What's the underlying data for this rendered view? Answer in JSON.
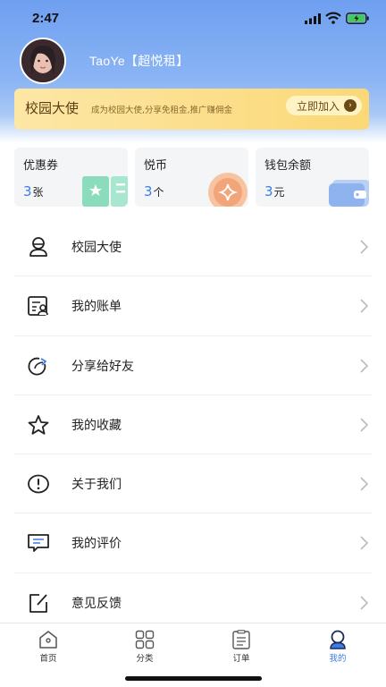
{
  "status_bar": {
    "time": "2:47"
  },
  "profile": {
    "username": "TaoYe【超悦租】"
  },
  "banner": {
    "title": "校园大使",
    "subtitle": "成为校园大使,分享免租金,推广赚佣金",
    "join_label": "立即加入",
    "join_arrow": "›"
  },
  "cards": [
    {
      "title": "优惠券",
      "value": "3",
      "unit": "张",
      "icon": "ticket-icon",
      "accent": "#5ac9a2"
    },
    {
      "title": "悦币",
      "value": "3",
      "unit": "个",
      "icon": "coin-icon",
      "accent": "#f3a57a"
    },
    {
      "title": "钱包余额",
      "value": "3",
      "unit": "元",
      "icon": "wallet-icon",
      "accent": "#8fb3ee"
    }
  ],
  "menu": [
    {
      "label": "校园大使",
      "icon": "ambassador-icon"
    },
    {
      "label": "我的账单",
      "icon": "bill-icon"
    },
    {
      "label": "分享给好友",
      "icon": "share-icon"
    },
    {
      "label": "我的收藏",
      "icon": "star-icon"
    },
    {
      "label": "关于我们",
      "icon": "info-icon"
    },
    {
      "label": "我的评价",
      "icon": "comment-icon"
    },
    {
      "label": "意见反馈",
      "icon": "feedback-icon"
    }
  ],
  "tabbar": [
    {
      "label": "首页",
      "icon": "home-icon",
      "active": false
    },
    {
      "label": "分类",
      "icon": "category-icon",
      "active": false
    },
    {
      "label": "订单",
      "icon": "order-icon",
      "active": false
    },
    {
      "label": "我的",
      "icon": "profile-icon",
      "active": true
    }
  ],
  "colors": {
    "accent": "#3d7be5",
    "header": "#6f9ff0",
    "banner": "#fbd877"
  }
}
